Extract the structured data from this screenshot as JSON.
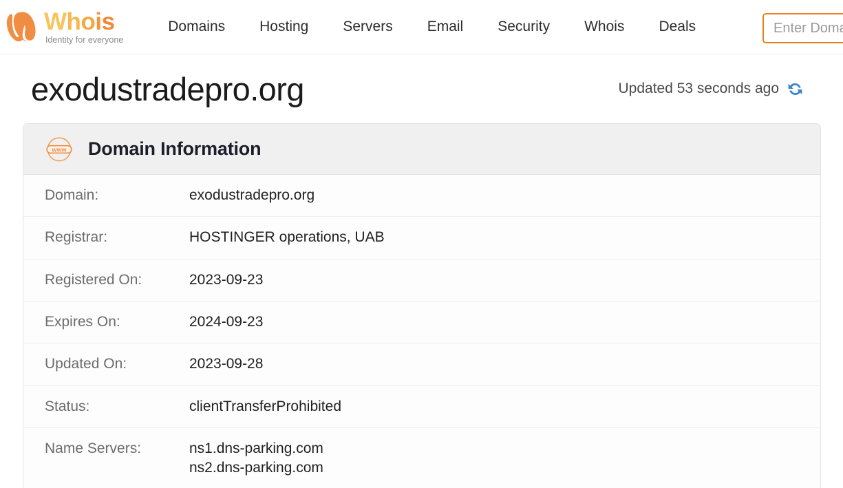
{
  "navbar": {
    "logo": {
      "mark": "whois-w-mark-icon",
      "word_parts": [
        "W",
        "h",
        "o",
        "i",
        "s"
      ],
      "word": "Whois",
      "tagline": "Identity for everyone",
      "brand_color": "#ef8935"
    },
    "links": [
      {
        "label": "Domains",
        "name": "nav-link-domains"
      },
      {
        "label": "Hosting",
        "name": "nav-link-hosting"
      },
      {
        "label": "Servers",
        "name": "nav-link-servers"
      },
      {
        "label": "Email",
        "name": "nav-link-email"
      },
      {
        "label": "Security",
        "name": "nav-link-security"
      },
      {
        "label": "Whois",
        "name": "nav-link-whois"
      },
      {
        "label": "Deals",
        "name": "nav-link-deals"
      }
    ],
    "search": {
      "placeholder": "Enter Domain Name",
      "value": "",
      "border_color": "#e8821e"
    }
  },
  "page": {
    "title": "exodustradepro.org",
    "updated_text": "Updated 53 seconds ago",
    "refresh_icon": "refresh-sync-icon",
    "refresh_icon_color": "#3d85c8"
  },
  "card": {
    "icon": "www-globe-icon",
    "icon_color": "#ef8935",
    "header_title": "Domain Information",
    "rows": [
      {
        "label": "Domain:",
        "value": "exodustradepro.org"
      },
      {
        "label": "Registrar:",
        "value": "HOSTINGER operations, UAB"
      },
      {
        "label": "Registered On:",
        "value": "2023-09-23"
      },
      {
        "label": "Expires On:",
        "value": "2024-09-23"
      },
      {
        "label": "Updated On:",
        "value": "2023-09-28"
      },
      {
        "label": "Status:",
        "value": "clientTransferProhibited"
      },
      {
        "label": "Name Servers:",
        "value": "ns1.dns-parking.com\nns2.dns-parking.com"
      }
    ]
  }
}
